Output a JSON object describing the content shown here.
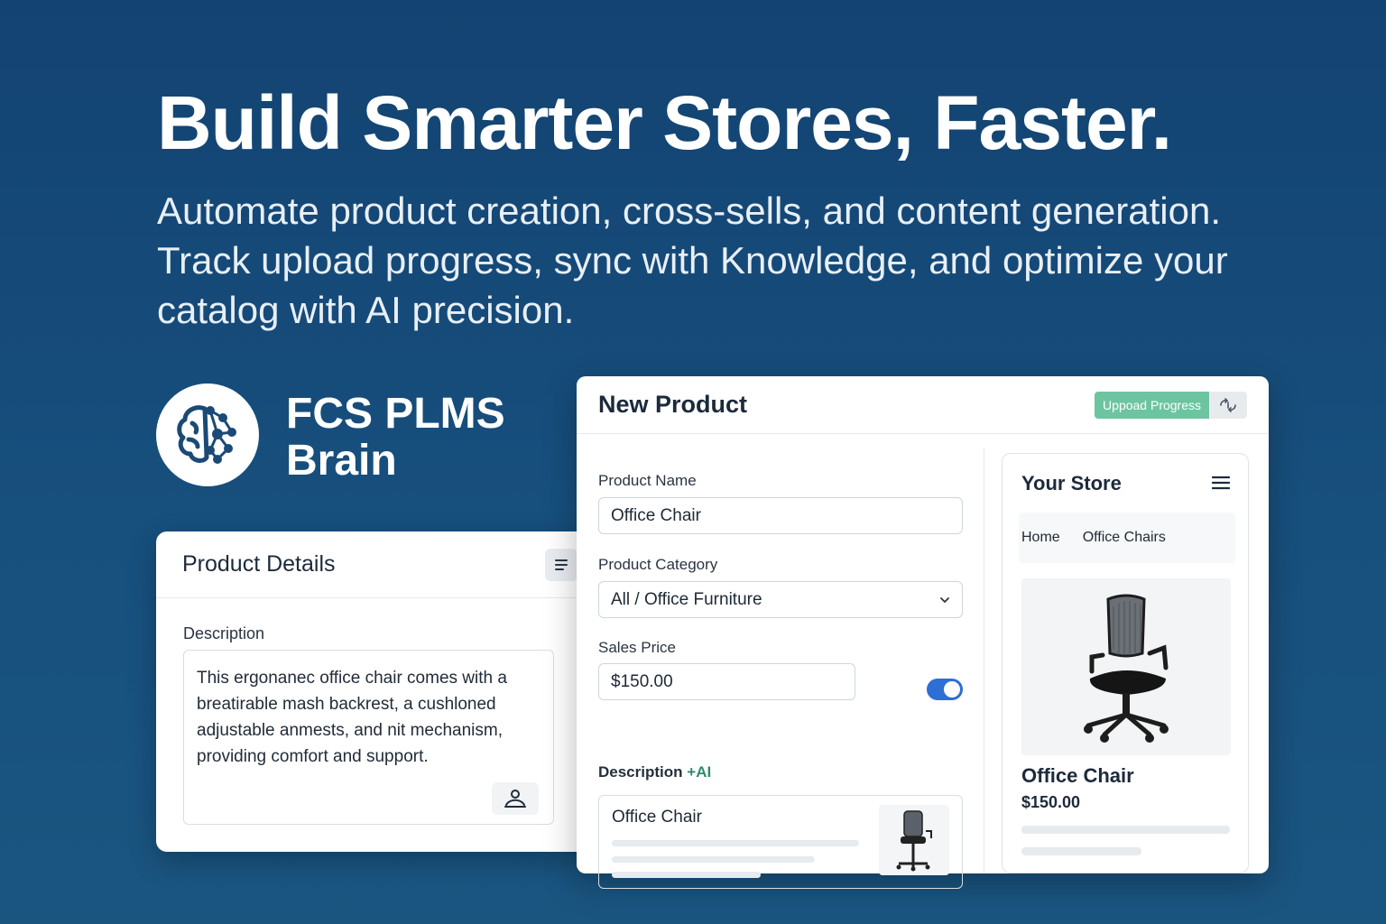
{
  "hero": {
    "headline": "Build Smarter Stores, Faster.",
    "subtext": "Automate product creation, cross-sells, and content generation. Track upload progress, sync with Knowledge, and optimize your catalog with AI precision."
  },
  "brand": {
    "line1": "FCS PLMS",
    "line2": "Brain",
    "logo_icon": "brain-network-icon"
  },
  "product_details": {
    "title": "Product Details",
    "description_label": "Description",
    "description_text": "This ergonanec office chair comes with a breatirable mash backrest, a cushloned adjustable anmests, and nit mechanism, providing comfort and support."
  },
  "new_product": {
    "title": "New Product",
    "upload_button": "Uppoad Progress",
    "fields": {
      "name_label": "Product Name",
      "name_value": "Office Chair",
      "category_label": "Product Category",
      "category_value": "All / Office Furniture",
      "price_label": "Sales Price",
      "price_value": "$150.00",
      "price_toggle_on": true,
      "description_label": "Description",
      "description_ai_tag": "+AI",
      "description_preview_title": "Office Chair"
    }
  },
  "store_preview": {
    "title": "Your Store",
    "nav": [
      "Home",
      "Office Chairs"
    ],
    "product_name": "Office Chair",
    "product_price": "$150.00"
  },
  "colors": {
    "background": "#134372",
    "accent_green": "#6cc4a0",
    "toggle_blue": "#2d6fd4",
    "ai_tag": "#2f8a6e"
  }
}
